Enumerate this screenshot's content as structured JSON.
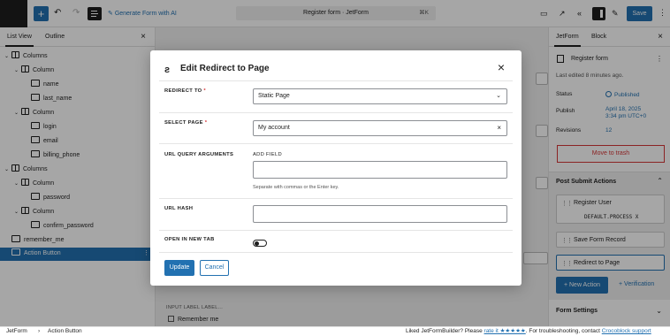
{
  "toolbar": {
    "generate_label": "Generate Form with AI",
    "doc_title": "Register form · JetForm",
    "shortcut": "⌘K",
    "save_label": "Save"
  },
  "left_panel": {
    "tabs": [
      "List View",
      "Outline"
    ],
    "items": [
      {
        "label": "Columns",
        "type": "columns",
        "depth": 0,
        "expanded": true
      },
      {
        "label": "Column",
        "type": "column",
        "depth": 1,
        "expanded": true
      },
      {
        "label": "name",
        "type": "field",
        "depth": 2
      },
      {
        "label": "last_name",
        "type": "field",
        "depth": 2
      },
      {
        "label": "Column",
        "type": "column",
        "depth": 1,
        "expanded": true
      },
      {
        "label": "login",
        "type": "field",
        "depth": 2
      },
      {
        "label": "email",
        "type": "field",
        "depth": 2
      },
      {
        "label": "billing_phone",
        "type": "field",
        "depth": 2
      },
      {
        "label": "Columns",
        "type": "columns",
        "depth": 0,
        "expanded": true
      },
      {
        "label": "Column",
        "type": "column",
        "depth": 1,
        "expanded": true
      },
      {
        "label": "password",
        "type": "field",
        "depth": 2
      },
      {
        "label": "Column",
        "type": "column",
        "depth": 1,
        "expanded": true
      },
      {
        "label": "confirm_password",
        "type": "field",
        "depth": 2
      },
      {
        "label": "remember_me",
        "type": "field",
        "depth": 0
      },
      {
        "label": "Action Button",
        "type": "button",
        "depth": 0,
        "selected": true
      }
    ]
  },
  "canvas": {
    "bottom_label": "INPUT LABEL  LABEL...",
    "remember_me": "Remember me"
  },
  "right_panel": {
    "tabs": [
      "JetForm",
      "Block"
    ],
    "doc_title": "Register form",
    "last_edited": "Last edited 8 minutes ago.",
    "status_label": "Status",
    "status_value": "Published",
    "publish_label": "Publish",
    "publish_date": "April 18, 2025",
    "publish_time": "3:34 pm UTC+0",
    "revisions_label": "Revisions",
    "revisions_value": "12",
    "trash_label": "Move to trash",
    "post_submit_title": "Post Submit Actions",
    "actions": [
      {
        "name": "Register User",
        "tag": "DEFAULT.PROCESS X"
      },
      {
        "name": "Save Form Record"
      },
      {
        "name": "Redirect to Page"
      }
    ],
    "new_action": "New Action",
    "verification": "Verification",
    "form_settings": "Form Settings"
  },
  "modal": {
    "title": "Edit Redirect to Page",
    "redirect_to_label": "REDIRECT TO",
    "redirect_to_value": "Static Page",
    "select_page_label": "SELECT PAGE",
    "select_page_value": "My account",
    "url_query_label": "URL QUERY ARGUMENTS",
    "add_field_label": "ADD FIELD",
    "add_field_help": "Separate with commas or the Enter key.",
    "url_hash_label": "URL HASH",
    "new_tab_label": "OPEN IN NEW TAB",
    "new_tab_on": false,
    "update_label": "Update",
    "cancel_label": "Cancel",
    "required_mark": "*"
  },
  "footer": {
    "crumb1": "JetForm",
    "crumb2": "Action Button",
    "msg_pre": "Liked JetFormBuilder? Please",
    "rate_link": "rate it ★★★★★",
    "msg_mid": ". For troubleshooting, contact",
    "support_link": "Crocoblock support"
  }
}
